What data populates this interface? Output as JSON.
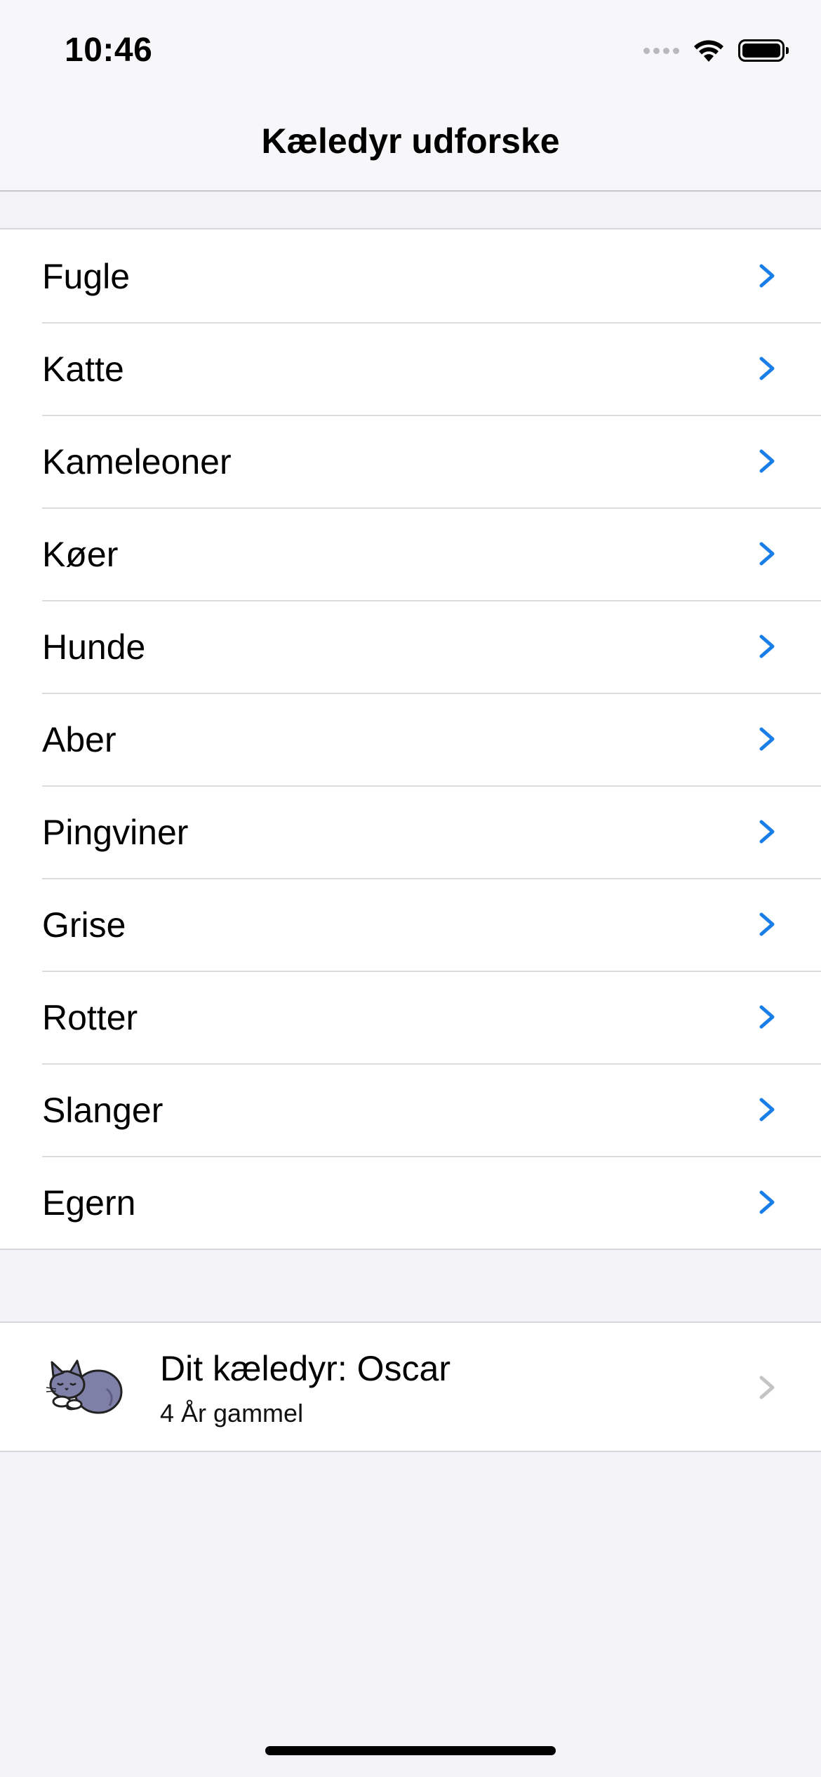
{
  "status_bar": {
    "time": "10:46"
  },
  "nav": {
    "title": "Kæledyr udforske"
  },
  "categories": [
    {
      "label": "Fugle"
    },
    {
      "label": "Katte"
    },
    {
      "label": "Kameleoner"
    },
    {
      "label": "Køer"
    },
    {
      "label": "Hunde"
    },
    {
      "label": "Aber"
    },
    {
      "label": "Pingviner"
    },
    {
      "label": "Grise"
    },
    {
      "label": "Rotter"
    },
    {
      "label": "Slanger"
    },
    {
      "label": "Egern"
    }
  ],
  "pet": {
    "title": "Dit kæledyr: Oscar",
    "subtitle": "4 År gammel",
    "avatar_icon": "sleeping-cat-icon"
  },
  "colors": {
    "accent": "#1a7ee8",
    "disabled_chevron": "#c4c4c7",
    "background": "#f2f2f7"
  }
}
